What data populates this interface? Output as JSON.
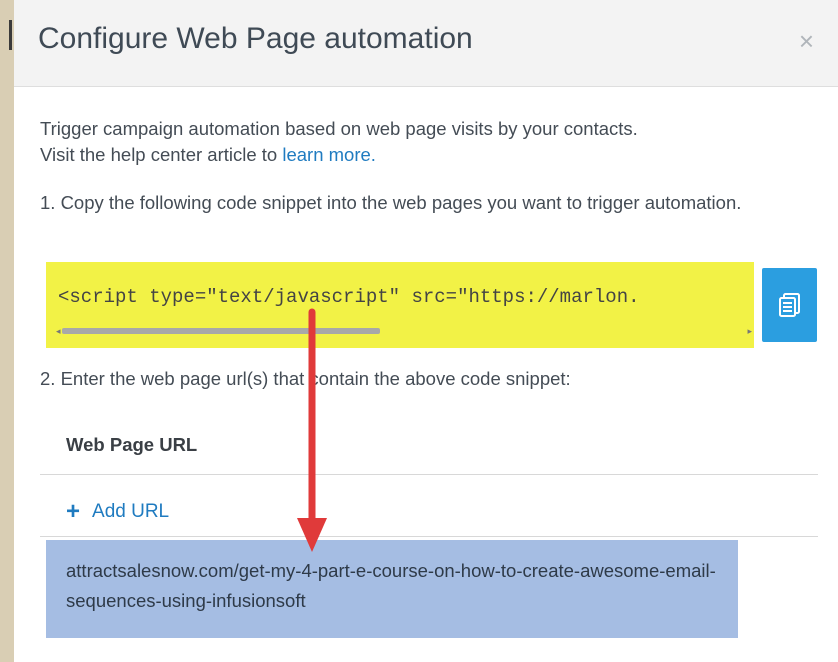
{
  "dialog": {
    "title": "Configure Web Page automation",
    "close_glyph": "×",
    "description_line1": "Trigger campaign automation based on web page visits by your contacts.",
    "description_line2_prefix": "Visit the help center article to ",
    "description_link": "learn more.",
    "step1": "1. Copy the following code snippet into the web pages you want to trigger automation.",
    "code_snippet": "<script type=\"text/javascript\" src=\"https://marlon.",
    "copy_button_icon": "copy-clipboard-icon",
    "step2": "2. Enter the web page url(s) that contain the above code snippet:",
    "table_header": "Web Page URL",
    "add_url_plus": "+",
    "add_url_label": "Add URL",
    "url_value": "attractsalesnow.com/get-my-4-part-e-course-on-how-to-create-awesome-email-sequences-using-infusionsoft"
  },
  "colors": {
    "highlight_yellow": "#f2f246",
    "button_blue": "#2b9ee0",
    "link_blue": "#1f7bc0",
    "row_highlight": "#a5bde3",
    "arrow_red": "#e03a3a",
    "page_background": "#d9ceb4"
  }
}
